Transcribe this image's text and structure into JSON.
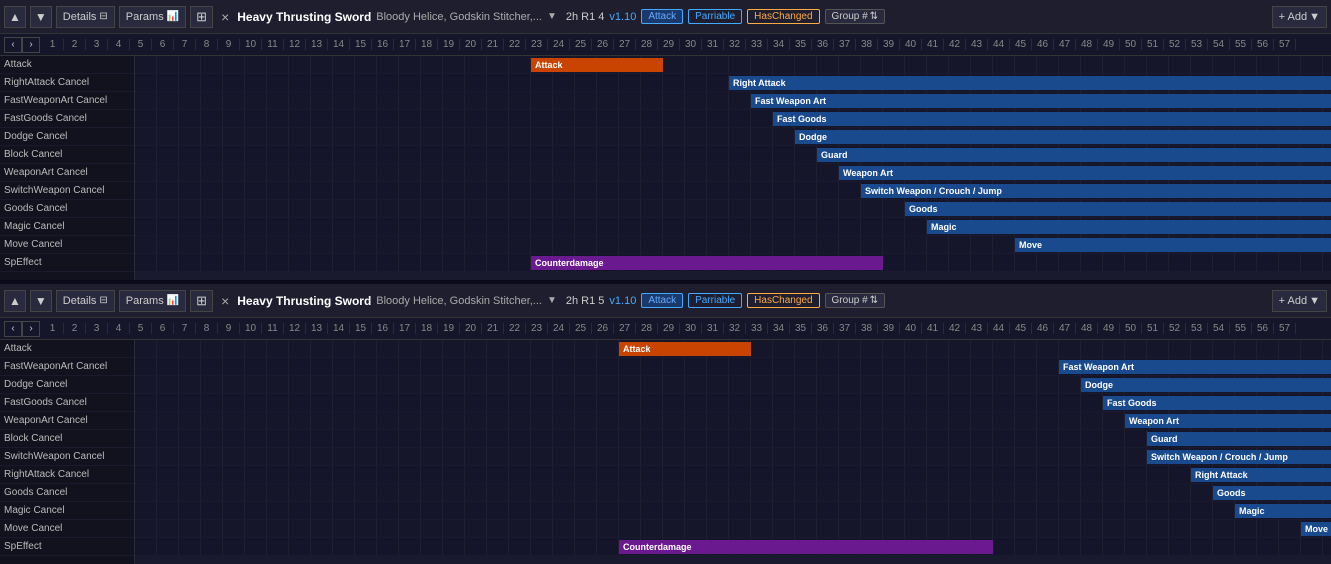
{
  "panels": [
    {
      "id": "panel1",
      "toolbar": {
        "up_label": "▲",
        "down_label": "▼",
        "details_label": "Details",
        "params_label": "Params",
        "grid_label": "⊞",
        "close_label": "×",
        "weapon_name": "Heavy Thrusting Sword",
        "weapon_sub": "Bloody Helice, Godskin Stitcher,...",
        "frame_info": "2h R1 4",
        "version": "v1.10",
        "attack_label": "Attack",
        "parriable_label": "Parriable",
        "haschanged_label": "HasChanged",
        "group_label": "Group #",
        "add_label": "+ Add"
      },
      "frames": [
        1,
        2,
        3,
        4,
        5,
        6,
        7,
        8,
        9,
        10,
        11,
        12,
        13,
        14,
        15,
        16,
        17,
        18,
        19,
        20,
        21,
        22,
        23,
        24,
        25,
        26,
        27,
        28,
        29,
        30,
        31,
        32,
        33,
        34,
        35,
        36,
        37,
        38,
        39,
        40,
        41,
        42,
        43,
        44,
        45,
        46,
        47,
        48,
        49,
        50,
        51,
        52,
        53,
        54,
        55,
        56,
        57
      ],
      "rows": [
        {
          "label": "Attack",
          "bars": [
            {
              "start": 19,
              "width": 6,
              "color": "orange",
              "text": "Attack"
            }
          ]
        },
        {
          "label": "RightAttack Cancel",
          "bars": [
            {
              "start": 28,
              "width": 30,
              "color": "blue",
              "text": "Right Attack"
            }
          ]
        },
        {
          "label": "FastWeaponArt Cancel",
          "bars": [
            {
              "start": 29,
              "width": 30,
              "color": "blue",
              "text": "Fast Weapon Art"
            }
          ]
        },
        {
          "label": "FastGoods Cancel",
          "bars": [
            {
              "start": 30,
              "width": 30,
              "color": "blue",
              "text": "Fast Goods"
            }
          ]
        },
        {
          "label": "Dodge Cancel",
          "bars": [
            {
              "start": 31,
              "width": 30,
              "color": "blue",
              "text": "Dodge"
            }
          ]
        },
        {
          "label": "Block Cancel",
          "bars": [
            {
              "start": 32,
              "width": 30,
              "color": "blue",
              "text": "Guard"
            }
          ]
        },
        {
          "label": "WeaponArt Cancel",
          "bars": [
            {
              "start": 33,
              "width": 30,
              "color": "blue",
              "text": "Weapon Art"
            }
          ]
        },
        {
          "label": "SwitchWeapon Cancel",
          "bars": [
            {
              "start": 34,
              "width": 30,
              "color": "blue",
              "text": "Switch Weapon / Crouch / Jump"
            }
          ]
        },
        {
          "label": "Goods Cancel",
          "bars": [
            {
              "start": 36,
              "width": 30,
              "color": "blue",
              "text": "Goods"
            }
          ]
        },
        {
          "label": "Magic Cancel",
          "bars": [
            {
              "start": 37,
              "width": 30,
              "color": "blue",
              "text": "Magic"
            }
          ]
        },
        {
          "label": "Move Cancel",
          "bars": [
            {
              "start": 41,
              "width": 30,
              "color": "blue",
              "text": "Move"
            }
          ]
        },
        {
          "label": "SpEffect",
          "bars": [
            {
              "start": 19,
              "width": 16,
              "color": "purple",
              "text": "Counterdamage"
            }
          ]
        }
      ]
    },
    {
      "id": "panel2",
      "toolbar": {
        "up_label": "▲",
        "down_label": "▼",
        "details_label": "Details",
        "params_label": "Params",
        "grid_label": "⊞",
        "close_label": "×",
        "weapon_name": "Heavy Thrusting Sword",
        "weapon_sub": "Bloody Helice, Godskin Stitcher,...",
        "frame_info": "2h R1 5",
        "version": "v1.10",
        "attack_label": "Attack",
        "parriable_label": "Parriable",
        "haschanged_label": "HasChanged",
        "group_label": "Group #",
        "add_label": "+ Add"
      },
      "frames": [
        1,
        2,
        3,
        4,
        5,
        6,
        7,
        8,
        9,
        10,
        11,
        12,
        13,
        14,
        15,
        16,
        17,
        18,
        19,
        20,
        21,
        22,
        23,
        24,
        25,
        26,
        27,
        28,
        29,
        30,
        31,
        32,
        33,
        34,
        35,
        36,
        37,
        38,
        39,
        40,
        41,
        42,
        43,
        44,
        45,
        46,
        47,
        48,
        49,
        50,
        51,
        52,
        53,
        54,
        55,
        56,
        57
      ],
      "rows": [
        {
          "label": "Attack",
          "bars": [
            {
              "start": 23,
              "width": 6,
              "color": "orange",
              "text": "Attack"
            }
          ]
        },
        {
          "label": "FastWeaponArt Cancel",
          "bars": [
            {
              "start": 43,
              "width": 30,
              "color": "blue",
              "text": "Fast Weapon Art"
            }
          ]
        },
        {
          "label": "Dodge Cancel",
          "bars": [
            {
              "start": 44,
              "width": 30,
              "color": "blue",
              "text": "Dodge"
            }
          ]
        },
        {
          "label": "FastGoods Cancel",
          "bars": [
            {
              "start": 45,
              "width": 30,
              "color": "blue",
              "text": "Fast Goods"
            }
          ]
        },
        {
          "label": "WeaponArt Cancel",
          "bars": [
            {
              "start": 46,
              "width": 30,
              "color": "blue",
              "text": "Weapon Art"
            }
          ]
        },
        {
          "label": "Block Cancel",
          "bars": [
            {
              "start": 47,
              "width": 30,
              "color": "blue",
              "text": "Guard"
            }
          ]
        },
        {
          "label": "SwitchWeapon Cancel",
          "bars": [
            {
              "start": 47,
              "width": 30,
              "color": "blue",
              "text": "Switch Weapon / Crouch / Jump"
            }
          ]
        },
        {
          "label": "RightAttack Cancel",
          "bars": [
            {
              "start": 49,
              "width": 30,
              "color": "blue",
              "text": "Right Attack"
            }
          ]
        },
        {
          "label": "Goods Cancel",
          "bars": [
            {
              "start": 50,
              "width": 30,
              "color": "blue",
              "text": "Goods"
            }
          ]
        },
        {
          "label": "Magic Cancel",
          "bars": [
            {
              "start": 51,
              "width": 30,
              "color": "blue",
              "text": "Magic"
            }
          ]
        },
        {
          "label": "Move Cancel",
          "bars": [
            {
              "start": 54,
              "width": 30,
              "color": "blue",
              "text": "Move"
            }
          ]
        },
        {
          "label": "SpEffect",
          "bars": [
            {
              "start": 23,
              "width": 17,
              "color": "purple",
              "text": "Counterdamage"
            }
          ]
        }
      ]
    }
  ]
}
